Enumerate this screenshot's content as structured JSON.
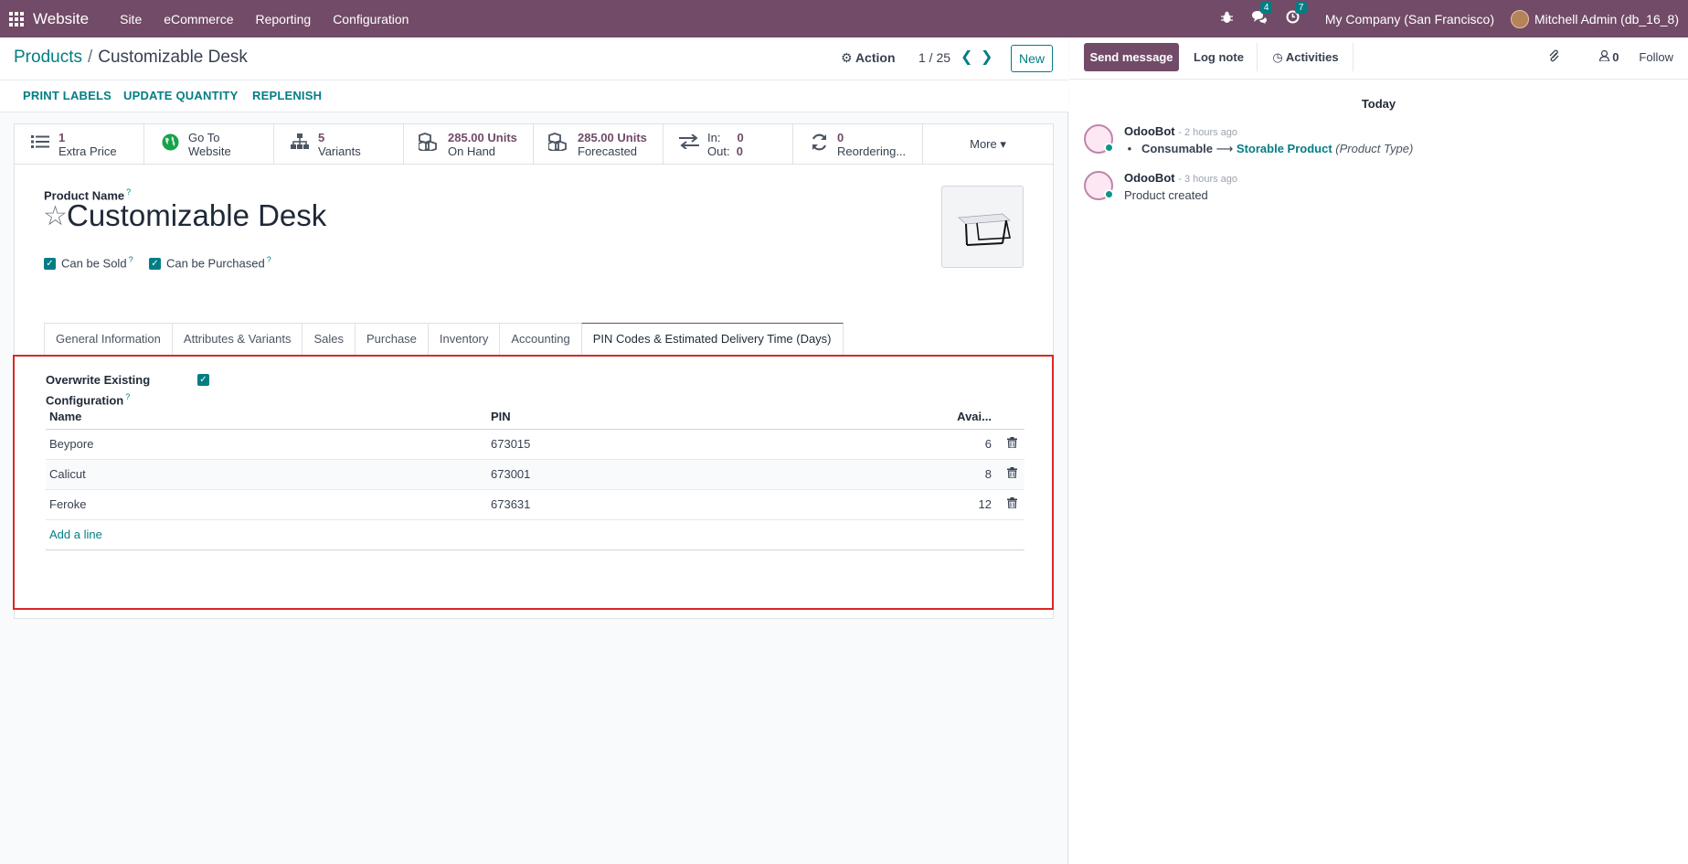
{
  "navbar": {
    "brand": "Website",
    "menu": [
      "Site",
      "eCommerce",
      "Reporting",
      "Configuration"
    ],
    "messages_badge": "4",
    "activities_badge": "7",
    "company": "My Company (San Francisco)",
    "user": "Mitchell Admin (db_16_8)",
    "accent_color": "#714B67"
  },
  "control": {
    "breadcrumb_parent": "Products",
    "breadcrumb_sep": "/",
    "breadcrumb_current": "Customizable Desk",
    "action_label": "Action",
    "pager": "1 / 25",
    "new_label": "New"
  },
  "actionbar": [
    "PRINT LABELS",
    "UPDATE QUANTITY",
    "REPLENISH"
  ],
  "smart_buttons": [
    {
      "icon": "list-icon",
      "value": "1",
      "label": "Extra Price"
    },
    {
      "icon": "globe-icon",
      "value": "Go To",
      "label": "Website"
    },
    {
      "icon": "sitemap-icon",
      "value": "5",
      "label": "Variants"
    },
    {
      "icon": "cubes-icon",
      "value": "285.00 Units",
      "label": "On Hand"
    },
    {
      "icon": "cubes-icon",
      "value": "285.00 Units",
      "label": "Forecasted"
    },
    {
      "icon": "exchange-icon",
      "value": "In:  0",
      "label": "Out:  0"
    },
    {
      "icon": "refresh-icon",
      "value": "0",
      "label": "Reordering..."
    },
    {
      "icon": "",
      "value": "More ▾",
      "label": ""
    }
  ],
  "form": {
    "product_name_label": "Product Name",
    "help": "?",
    "product_name": "Customizable Desk",
    "can_be_sold": "Can be Sold",
    "can_be_purchased": "Can be Purchased",
    "tabs": [
      "General Information",
      "Attributes & Variants",
      "Sales",
      "Purchase",
      "Inventory",
      "Accounting",
      "PIN Codes & Estimated Delivery Time (Days)"
    ],
    "active_tab": "PIN Codes & Estimated Delivery Time (Days)",
    "overwrite_label": "Overwrite Existing Configuration"
  },
  "pin_table": {
    "headers": {
      "name": "Name",
      "pin": "PIN",
      "avail": "Avai..."
    },
    "rows": [
      {
        "name": "Beypore",
        "pin": "673015",
        "avail": "6"
      },
      {
        "name": "Calicut",
        "pin": "673001",
        "avail": "8"
      },
      {
        "name": "Feroke",
        "pin": "673631",
        "avail": "12"
      }
    ],
    "add_line": "Add a line"
  },
  "chatter": {
    "send_message": "Send message",
    "log_note": "Log note",
    "activities": "Activities",
    "followers_count": "0",
    "follow": "Follow",
    "today": "Today",
    "messages": [
      {
        "author": "OdooBot",
        "time": "- 2 hours ago",
        "old_value": "Consumable",
        "new_value": "Storable Product",
        "field": "(Product Type)"
      },
      {
        "author": "OdooBot",
        "time": "- 3 hours ago",
        "body": "Product created"
      }
    ]
  }
}
